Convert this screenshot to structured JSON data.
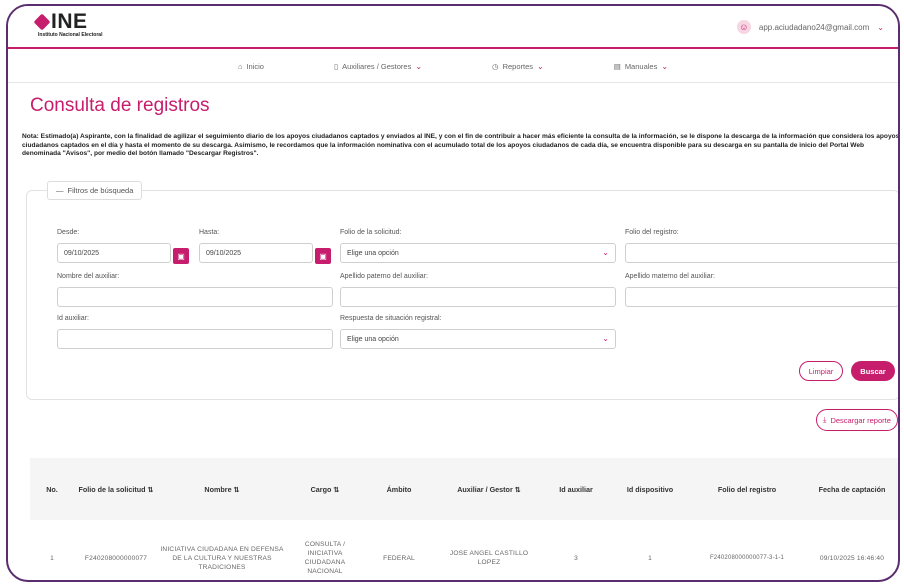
{
  "brand": {
    "name": "INE",
    "subtitle": "Instituto Nacional Electoral"
  },
  "user": {
    "email": "app.aciudadano24@gmail.com",
    "avatar_icon": "user-icon",
    "caret": "⌄"
  },
  "nav": [
    {
      "icon": "⌂",
      "label": "Inicio",
      "caret": ""
    },
    {
      "icon": "▯",
      "label": "Auxiliares / Gestores",
      "caret": "⌄"
    },
    {
      "icon": "◷",
      "label": "Reportes",
      "caret": "⌄"
    },
    {
      "icon": "▤",
      "label": "Manuales",
      "caret": "⌄"
    }
  ],
  "page_title": "Consulta de registros",
  "note": "Nota: Estimado(a) Aspirante, con la finalidad de agilizar el seguimiento diario de los apoyos ciudadanos captados y enviados al INE, y con el fin de contribuir a hacer más eficiente la consulta de la información, se le dispone la descarga de la información que considera los apoyos ciudadanos captados en el día y hasta el momento de su descarga. Asimismo, le recordamos que la información nominativa con el acumulado total de los apoyos ciudadanos de cada día, se encuentra disponible para su descarga en su pantalla de inicio del Portal Web denominada \"Avisos\", por medio del botón llamado \"Descargar Registros\".",
  "filters": {
    "legend": "Filtros de búsqueda",
    "legend_icon": "—",
    "desde_label": "Desde:",
    "desde_value": "09/10/2025",
    "hasta_label": "Hasta:",
    "hasta_value": "09/10/2025",
    "folio_solicitud_label": "Folio de la solicitud:",
    "folio_solicitud_value": "Elige una opción",
    "folio_registro_label": "Folio del registro:",
    "nombre_aux_label": "Nombre del auxiliar:",
    "ap_paterno_label": "Apellido paterno del auxiliar:",
    "ap_materno_label": "Apellido materno del auxiliar:",
    "id_aux_label": "Id auxiliar:",
    "respuesta_label": "Respuesta de situación registral:",
    "respuesta_value": "Elige una opción",
    "select_caret": "⌄",
    "cal_icon": "▣",
    "clear_label": "Limpiar",
    "search_label": "Buscar"
  },
  "download": {
    "label": "Descargar reporte",
    "icon": "⤓"
  },
  "table": {
    "headers": [
      "No.",
      "Folio de la solicitud ⇅",
      "Nombre ⇅",
      "Cargo ⇅",
      "Ámbito",
      "Auxiliar / Gestor ⇅",
      "Id auxiliar",
      "Id dispositivo",
      "Folio del registro",
      "Fecha de captación"
    ],
    "rows": [
      [
        "1",
        "F240208000000077",
        "INICIATIVA CIUDADANA EN DEFENSA DE LA CULTURA Y NUESTRAS TRADICIONES",
        "CONSULTA / INICIATIVA CIUDADANA NACIONAL",
        "FEDERAL",
        "JOSE ANGEL CASTILLO LOPEZ",
        "3",
        "1",
        "F240208000000077-3-1-1",
        "09/10/2025 16:46:40"
      ]
    ]
  }
}
